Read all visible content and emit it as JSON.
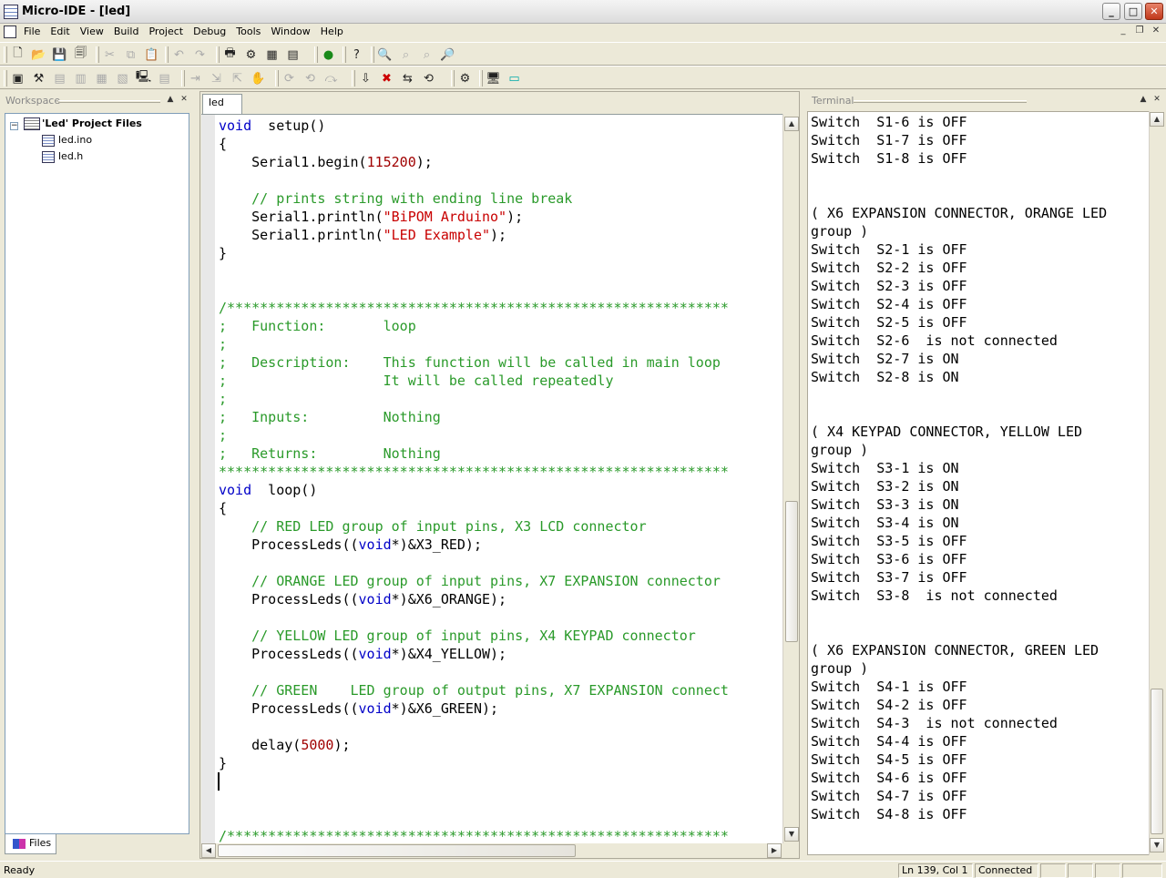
{
  "window": {
    "title": "Micro-IDE - [led]",
    "min": "_",
    "max": "□",
    "close": "✕"
  },
  "menu": [
    "File",
    "Edit",
    "View",
    "Build",
    "Project",
    "Debug",
    "Tools",
    "Window",
    "Help"
  ],
  "mdi": {
    "min": "_",
    "restore": "❐",
    "close": "✕"
  },
  "workspace": {
    "header": "Workspace",
    "tree": {
      "root": "'Led' Project Files",
      "files": [
        "led.ino",
        "led.h"
      ]
    },
    "tab": "Files"
  },
  "editor": {
    "tab": "led",
    "lines": [
      [
        [
          "kw",
          "void"
        ],
        [
          "",
          "  setup()"
        ]
      ],
      [
        [
          "",
          "{"
        ]
      ],
      [
        [
          "",
          "    Serial1.begin("
        ],
        [
          "num",
          "115200"
        ],
        [
          "",
          ");"
        ]
      ],
      [
        [
          "",
          ""
        ]
      ],
      [
        [
          "cm",
          "    // prints string with ending line break"
        ]
      ],
      [
        [
          "",
          "    Serial1.println("
        ],
        [
          "str",
          "\"BiPOM Arduino\""
        ],
        [
          "",
          ");"
        ]
      ],
      [
        [
          "",
          "    Serial1.println("
        ],
        [
          "str",
          "\"LED Example\""
        ],
        [
          "",
          ");"
        ]
      ],
      [
        [
          "",
          "}"
        ]
      ],
      [
        [
          "",
          ""
        ]
      ],
      [
        [
          "",
          ""
        ]
      ],
      [
        [
          "cm",
          "/*************************************************************"
        ]
      ],
      [
        [
          "cm",
          ";   Function:       loop"
        ]
      ],
      [
        [
          "cm",
          ";"
        ]
      ],
      [
        [
          "cm",
          ";   Description:    This function will be called in main loop"
        ]
      ],
      [
        [
          "cm",
          ";                   It will be called repeatedly"
        ]
      ],
      [
        [
          "cm",
          ";"
        ]
      ],
      [
        [
          "cm",
          ";   Inputs:         Nothing"
        ]
      ],
      [
        [
          "cm",
          ";"
        ]
      ],
      [
        [
          "cm",
          ";   Returns:        Nothing"
        ]
      ],
      [
        [
          "cm",
          "**************************************************************"
        ]
      ],
      [
        [
          "kw",
          "void"
        ],
        [
          "",
          "  loop()"
        ]
      ],
      [
        [
          "",
          "{"
        ]
      ],
      [
        [
          "cm",
          "    // RED LED group of input pins, X3 LCD connector"
        ]
      ],
      [
        [
          "",
          "    ProcessLeds(("
        ],
        [
          "kw",
          "void"
        ],
        [
          "",
          "*)&X3_RED);"
        ]
      ],
      [
        [
          "",
          ""
        ]
      ],
      [
        [
          "cm",
          "    // ORANGE LED group of input pins, X7 EXPANSION connector"
        ]
      ],
      [
        [
          "",
          "    ProcessLeds(("
        ],
        [
          "kw",
          "void"
        ],
        [
          "",
          "*)&X6_ORANGE);"
        ]
      ],
      [
        [
          "",
          ""
        ]
      ],
      [
        [
          "cm",
          "    // YELLOW LED group of input pins, X4 KEYPAD connector"
        ]
      ],
      [
        [
          "",
          "    ProcessLeds(("
        ],
        [
          "kw",
          "void"
        ],
        [
          "",
          "*)&X4_YELLOW);"
        ]
      ],
      [
        [
          "",
          ""
        ]
      ],
      [
        [
          "cm",
          "    // GREEN    LED group of output pins, X7 EXPANSION connect"
        ]
      ],
      [
        [
          "",
          "    ProcessLeds(("
        ],
        [
          "kw",
          "void"
        ],
        [
          "",
          "*)&X6_GREEN);"
        ]
      ],
      [
        [
          "",
          ""
        ]
      ],
      [
        [
          "",
          "    delay("
        ],
        [
          "num",
          "5000"
        ],
        [
          "",
          ");"
        ]
      ],
      [
        [
          "",
          "}"
        ]
      ],
      [
        [
          "",
          ""
        ]
      ],
      [
        [
          "",
          ""
        ]
      ],
      [
        [
          "",
          ""
        ]
      ],
      [
        [
          "cm",
          "/*************************************************************"
        ]
      ]
    ]
  },
  "terminal": {
    "header": "Terminal",
    "lines": [
      "Switch  S1-6 is OFF",
      "Switch  S1-7 is OFF",
      "Switch  S1-8 is OFF",
      "",
      "",
      "( X6 EXPANSION CONNECTOR, ORANGE LED",
      "group )",
      "Switch  S2-1 is OFF",
      "Switch  S2-2 is OFF",
      "Switch  S2-3 is OFF",
      "Switch  S2-4 is OFF",
      "Switch  S2-5 is OFF",
      "Switch  S2-6  is not connected",
      "Switch  S2-7 is ON",
      "Switch  S2-8 is ON",
      "",
      "",
      "( X4 KEYPAD CONNECTOR, YELLOW LED",
      "group )",
      "Switch  S3-1 is ON",
      "Switch  S3-2 is ON",
      "Switch  S3-3 is ON",
      "Switch  S3-4 is ON",
      "Switch  S3-5 is OFF",
      "Switch  S3-6 is OFF",
      "Switch  S3-7 is OFF",
      "Switch  S3-8  is not connected",
      "",
      "",
      "( X6 EXPANSION CONNECTOR, GREEN LED",
      "group )",
      "Switch  S4-1 is OFF",
      "Switch  S4-2 is OFF",
      "Switch  S4-3  is not connected",
      "Switch  S4-4 is OFF",
      "Switch  S4-5 is OFF",
      "Switch  S4-6 is OFF",
      "Switch  S4-7 is OFF",
      "Switch  S4-8 is OFF"
    ]
  },
  "status": {
    "ready": "Ready",
    "position": "Ln 139, Col 1",
    "connection": "Connected"
  },
  "toolbar1": [
    {
      "name": "new-file-icon",
      "glyph": "🗋"
    },
    {
      "name": "open-icon",
      "glyph": "📂"
    },
    {
      "name": "save-icon",
      "glyph": "💾"
    },
    {
      "name": "save-all-icon",
      "glyph": "🗐"
    },
    {
      "name": "cut-icon",
      "glyph": "✂",
      "dim": true
    },
    {
      "name": "copy-icon",
      "glyph": "⧉",
      "dim": true
    },
    {
      "name": "paste-icon",
      "glyph": "📋",
      "dim": true
    },
    {
      "name": "undo-icon",
      "glyph": "↶",
      "dim": true
    },
    {
      "name": "redo-icon",
      "glyph": "↷",
      "dim": true
    },
    {
      "name": "print-icon",
      "glyph": "🖶"
    },
    {
      "name": "compile-icon",
      "glyph": "⚙"
    },
    {
      "name": "build-icon",
      "glyph": "▦"
    },
    {
      "name": "build-all-icon",
      "glyph": "▤"
    },
    {
      "name": "run-icon",
      "glyph": "●",
      "color": "#1a8a1a"
    },
    {
      "name": "help-icon",
      "glyph": "?"
    },
    {
      "name": "find-icon",
      "glyph": "🔍"
    },
    {
      "name": "find-next-icon",
      "glyph": "⌕",
      "dim": true
    },
    {
      "name": "find-prev-icon",
      "glyph": "⌕",
      "dim": true
    },
    {
      "name": "find-in-files-icon",
      "glyph": "🔎"
    }
  ],
  "toolbar2": [
    {
      "name": "workspace-toggle-icon",
      "glyph": "▣"
    },
    {
      "name": "properties-icon",
      "glyph": "⚒"
    },
    {
      "name": "output-icon",
      "glyph": "▤",
      "dim": true
    },
    {
      "name": "watch-icon",
      "glyph": "▥",
      "dim": true
    },
    {
      "name": "memory-icon",
      "glyph": "▦",
      "dim": true
    },
    {
      "name": "registers-icon",
      "glyph": "▧",
      "dim": true
    },
    {
      "name": "terminal-icon",
      "glyph": "🖳"
    },
    {
      "name": "console-icon",
      "glyph": "▤",
      "dim": true
    },
    {
      "name": "step-icon",
      "glyph": "⇥",
      "dim": true
    },
    {
      "name": "step-into-icon",
      "glyph": "⇲",
      "dim": true
    },
    {
      "name": "step-out-icon",
      "glyph": "⇱",
      "dim": true
    },
    {
      "name": "stop-icon",
      "glyph": "✋"
    },
    {
      "name": "breakpoint-icon",
      "glyph": "⟳",
      "dim": true
    },
    {
      "name": "clear-breakpoint-icon",
      "glyph": "⟲",
      "dim": true
    },
    {
      "name": "run-to-icon",
      "glyph": "⤼",
      "dim": true
    },
    {
      "name": "download-icon",
      "glyph": "⇩"
    },
    {
      "name": "disconnect-icon",
      "glyph": "✖",
      "color": "#c00"
    },
    {
      "name": "connect-icon",
      "glyph": "⇆"
    },
    {
      "name": "reset-icon",
      "glyph": "⟲"
    },
    {
      "name": "options-icon",
      "glyph": "⚙"
    },
    {
      "name": "monitor-icon",
      "glyph": "🖥"
    },
    {
      "name": "screen-icon",
      "glyph": "▭",
      "color": "#0aa"
    }
  ]
}
